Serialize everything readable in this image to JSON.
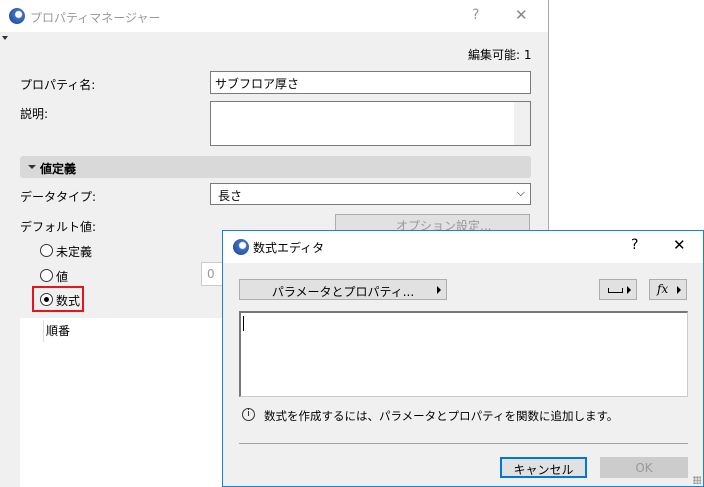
{
  "main": {
    "title": "プロパティマネージャー",
    "help": "?",
    "close": "✕",
    "editable": "編集可能: 1",
    "name_label": "プロパティ名:",
    "name_value": "サブフロア厚さ",
    "desc_label": "説明:",
    "section": "値定義",
    "datatype_label": "データタイプ:",
    "datatype_value": "長さ",
    "default_label": "デフォルト値:",
    "options_button": "オプション設定...",
    "radios": [
      {
        "label": "未定義",
        "selected": false
      },
      {
        "label": "値",
        "selected": false
      },
      {
        "label": "数式",
        "selected": true
      }
    ],
    "value_field": "0",
    "list_header": "順番"
  },
  "dialog": {
    "title": "数式エディタ",
    "help": "?",
    "close": "✕",
    "params_button": "パラメータとプロパティ...",
    "info": "数式を作成するには、パラメータとプロパティを関数に追加します。",
    "cancel": "キャンセル",
    "ok": "OK",
    "fx": "fx"
  }
}
